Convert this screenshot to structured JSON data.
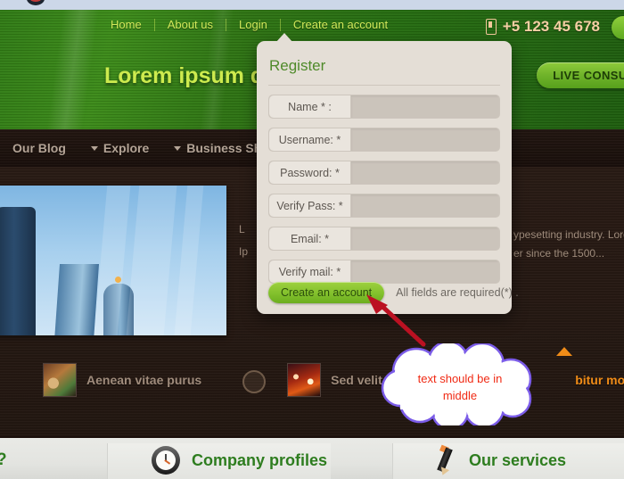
{
  "topnav": {
    "items": [
      {
        "label": "Home"
      },
      {
        "label": "About us"
      },
      {
        "label": "Login"
      },
      {
        "label": "Create an account"
      }
    ]
  },
  "header": {
    "phone_number": "+5 123 45 678",
    "phone_icon": "mobile-phone-icon",
    "slogan": "Lorem ipsum dolor",
    "live_consult_label": "LIVE CONSUL"
  },
  "darknav": {
    "items": [
      {
        "label": "Our Blog",
        "has_caret": false
      },
      {
        "label": "Explore",
        "has_caret": true
      },
      {
        "label": "Business Showcas",
        "has_caret": true
      }
    ]
  },
  "content": {
    "hero_text_line1": "ypesetting industry. Lore",
    "hero_text_line2": "er since the 1500...",
    "hero_text_left_line1": "L",
    "hero_text_left_line2": "Ip",
    "thumbs": [
      {
        "label": "Aenean vitae purus",
        "image": "music-thumbnail",
        "color": "#a08c7c"
      },
      {
        "label": "Sed velit ligula",
        "image": "night-lights-thumbnail",
        "color": "#a08c7c"
      },
      {
        "label": "bitur mollis",
        "image": "none",
        "color": "#f08c18"
      }
    ]
  },
  "footer": {
    "left_fragment": "?",
    "items": [
      {
        "label": "Company profiles",
        "icon": "clock-icon"
      },
      {
        "label": "Our services",
        "icon": "pencil-icon"
      }
    ]
  },
  "dialog": {
    "title": "Register",
    "fields": [
      {
        "label": "Name * :",
        "value": "",
        "placeholder": ""
      },
      {
        "label": "Username: *",
        "value": "",
        "placeholder": ""
      },
      {
        "label": "Password: *",
        "value": "",
        "placeholder": ""
      },
      {
        "label": "Verify Pass: *",
        "value": "",
        "placeholder": ""
      },
      {
        "label": "Email: *",
        "value": "",
        "placeholder": ""
      },
      {
        "label": "Verify mail: *",
        "value": "",
        "placeholder": ""
      }
    ],
    "submit_label": "Create an account",
    "required_note": "All fields are required(*) ."
  },
  "annotations": {
    "cloud_text_line1": "text should be in",
    "cloud_text_line2": "middle",
    "cloud_text_color": "#f02a14",
    "arrow_color": "#bb1122"
  },
  "colors": {
    "header_green": "#2d7312",
    "accent_lime": "#cdeb4e",
    "dialog_bg": "#e4ded6",
    "dark_brown": "#241812",
    "footer_green": "#2e7d1f",
    "orange": "#f08c18"
  }
}
